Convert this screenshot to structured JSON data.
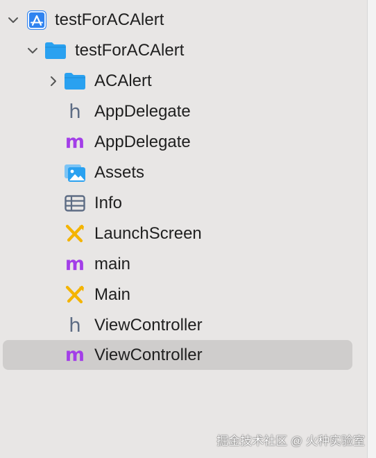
{
  "project": {
    "name": "testForACAlert",
    "expanded": true,
    "icon": "xcode-project-icon"
  },
  "group": {
    "name": "testForACAlert",
    "expanded": true,
    "icon": "folder-icon"
  },
  "items": [
    {
      "label": "ACAlert",
      "icon": "folder-icon",
      "expandable": true,
      "expanded": false
    },
    {
      "label": "AppDelegate",
      "icon": "header-file-icon",
      "glyph": "h"
    },
    {
      "label": "AppDelegate",
      "icon": "objc-source-file-icon",
      "glyph": "m"
    },
    {
      "label": "Assets",
      "icon": "asset-catalog-icon"
    },
    {
      "label": "Info",
      "icon": "plist-table-icon"
    },
    {
      "label": "LaunchScreen",
      "icon": "storyboard-icon"
    },
    {
      "label": "main",
      "icon": "objc-source-file-icon",
      "glyph": "m"
    },
    {
      "label": "Main",
      "icon": "storyboard-icon"
    },
    {
      "label": "ViewController",
      "icon": "header-file-icon",
      "glyph": "h"
    },
    {
      "label": "ViewController",
      "icon": "objc-source-file-icon",
      "glyph": "m",
      "selected": true
    }
  ],
  "colors": {
    "background": "#e8e6e5",
    "selection": "#cfcdcc",
    "folder": "#2aa1f0",
    "header_glyph": "#5d6c84",
    "source_glyph": "#a33ee8",
    "storyboard": "#f4b400"
  },
  "watermark": "掘金技术社区 @ 火种实验室"
}
